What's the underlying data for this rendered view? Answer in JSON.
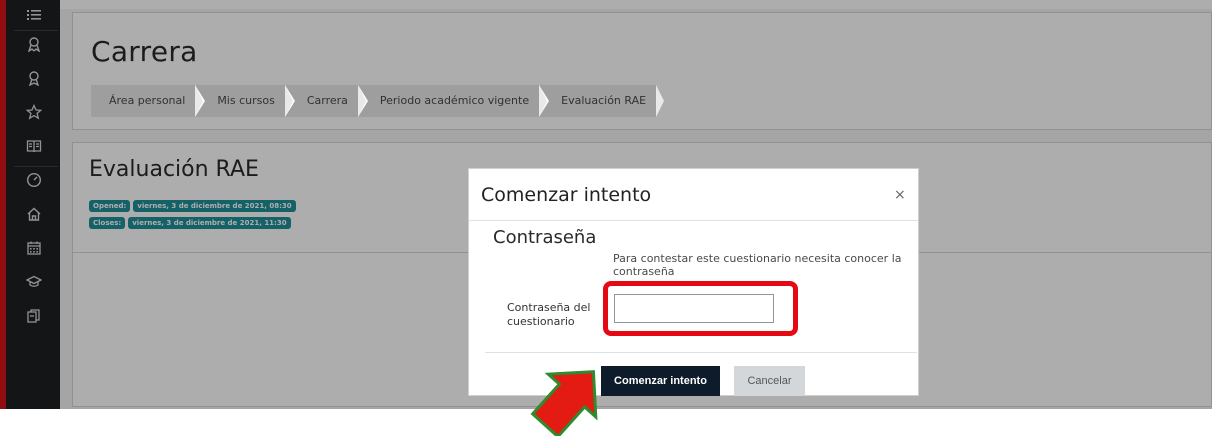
{
  "rail": {
    "icons": [
      "list-icon",
      "award-icon",
      "badge-icon",
      "star-icon",
      "book-icon",
      "dashboard-icon",
      "home-icon",
      "calendar-icon",
      "graduation-cap-icon",
      "content-bank-icon"
    ]
  },
  "page": {
    "title": "Carrera",
    "breadcrumb": [
      "Área personal",
      "Mis cursos",
      "Carrera",
      "Periodo académico vigente",
      "Evaluación RAE"
    ]
  },
  "quiz": {
    "title": "Evaluación RAE",
    "opened_label": "Opened:",
    "opened_value": "viernes, 3 de diciembre de 2021, 08:30",
    "closes_label": "Closes:",
    "closes_value": "viernes, 3 de diciembre de 2021, 11:30",
    "badge_color": "#1f8f9a"
  },
  "modal": {
    "title": "Comenzar intento",
    "close_symbol": "×",
    "section_title": "Contraseña",
    "info": "Para contestar este cuestionario necesita conocer la contraseña",
    "password_label": "Contraseña del cuestionario",
    "password_value": "",
    "start_button": "Comenzar intento",
    "cancel_button": "Cancelar"
  },
  "colors": {
    "highlight": "#e50914",
    "arrow_fill": "#e31b13",
    "arrow_stroke": "#2e8b2e",
    "primary": "#0d1b2a",
    "rail_accent": "#d4161b"
  }
}
